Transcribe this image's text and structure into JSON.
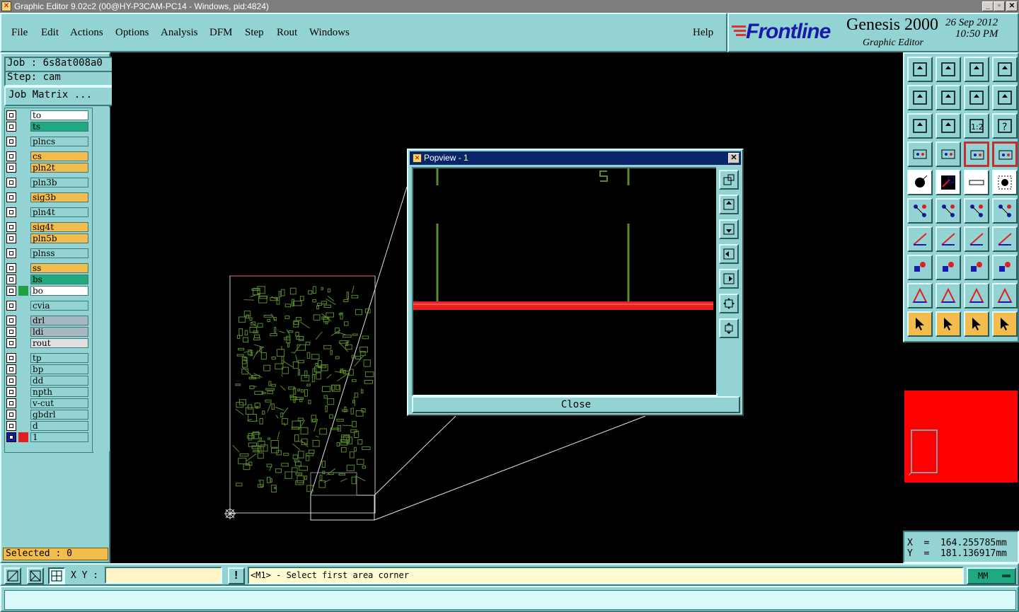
{
  "window": {
    "title": "Graphic Editor 9.02c2 (00@HY-P3CAM-PC14 - Windows, pid:4824)",
    "min_label": "_",
    "max_label": "▫",
    "close_label": "✕"
  },
  "menu": {
    "items": [
      "File",
      "Edit",
      "Actions",
      "Options",
      "Analysis",
      "DFM",
      "Step",
      "Rout",
      "Windows"
    ],
    "help": "Help"
  },
  "logo": {
    "brand": "Frontline",
    "product": "Genesis 2000",
    "subtitle": "Graphic Editor",
    "date": "26 Sep 2012",
    "time": "10:50 PM"
  },
  "job": {
    "job_line": "Job : 6s8at008a0",
    "step_line": "Step: cam",
    "matrix_button": "Job Matrix ..."
  },
  "layers": [
    {
      "name": "to",
      "color": "#ffffff"
    },
    {
      "name": "ts",
      "color": "#20a880"
    },
    {
      "name": "plncs",
      "color": "#94d3d3"
    },
    {
      "name": "cs",
      "color": "#f2bd4d"
    },
    {
      "name": "pln2t",
      "color": "#f2bd4d"
    },
    {
      "name": "pln3b",
      "color": "#94d3d3"
    },
    {
      "name": "sig3b",
      "color": "#f2bd4d"
    },
    {
      "name": "pln4t",
      "color": "#94d3d3"
    },
    {
      "name": "sig4t",
      "color": "#f2bd4d"
    },
    {
      "name": "pln5b",
      "color": "#f2bd4d"
    },
    {
      "name": "plnss",
      "color": "#94d3d3"
    },
    {
      "name": "ss",
      "color": "#f2bd4d"
    },
    {
      "name": "bs",
      "color": "#20a880"
    },
    {
      "name": "bo",
      "color": "#ffffff"
    },
    {
      "name": "cvia",
      "color": "#94d3d3"
    },
    {
      "name": "drl",
      "color": "#a8b8c0"
    },
    {
      "name": "ldi",
      "color": "#a8b8c0"
    },
    {
      "name": "rout",
      "color": "#e0e0e0"
    },
    {
      "name": "tp",
      "color": "#94d3d3"
    },
    {
      "name": "bp",
      "color": "#94d3d3"
    },
    {
      "name": "dd",
      "color": "#94d3d3"
    },
    {
      "name": "npth",
      "color": "#94d3d3"
    },
    {
      "name": "v-cut",
      "color": "#94d3d3"
    },
    {
      "name": "gbdrl",
      "color": "#94d3d3"
    },
    {
      "name": "d",
      "color": "#94d3d3"
    },
    {
      "name": "1",
      "color": "#94d3d3"
    }
  ],
  "selected": "Selected : 0",
  "popview": {
    "title": "Popview - 1",
    "close_button": "Close",
    "close_x": "✕"
  },
  "coords": {
    "x": "X  =  164.255785mm",
    "y": "Y  =  181.136917mm"
  },
  "bottom": {
    "xy_label": "X Y :",
    "xy_value": "",
    "message": "<M1> - Select first area corner",
    "units": "MM",
    "info_icon": "!"
  }
}
